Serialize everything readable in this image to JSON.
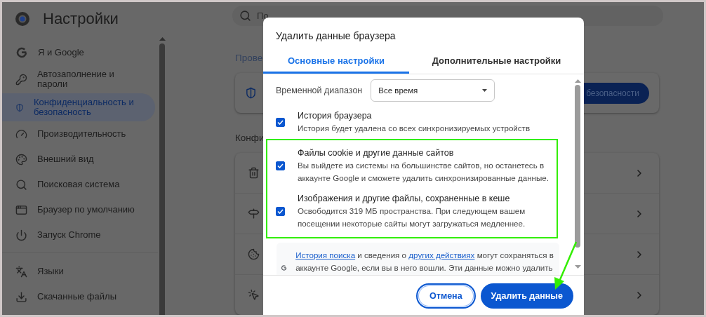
{
  "sidebar": {
    "title": "Настройки",
    "items": [
      {
        "label": "Я и Google",
        "selected": false
      },
      {
        "label": "Автозаполнение и пароли",
        "selected": false
      },
      {
        "label": "Конфиденциальность и безопасность",
        "selected": true
      },
      {
        "label": "Производительность",
        "selected": false
      },
      {
        "label": "Внешний вид",
        "selected": false
      },
      {
        "label": "Поисковая система",
        "selected": false
      },
      {
        "label": "Браузер по умолчанию",
        "selected": false
      },
      {
        "label": "Запуск Chrome",
        "selected": false
      }
    ],
    "more_items": [
      {
        "label": "Языки",
        "selected": false
      },
      {
        "label": "Скачанные файлы",
        "selected": false
      }
    ]
  },
  "search": {
    "placeholder": "По"
  },
  "main": {
    "section_1_heading": "Прове",
    "safety_button": "безопасности",
    "section_2_heading": "Конфи"
  },
  "dialog": {
    "title": "Удалить данные браузера",
    "tabs": [
      {
        "label": "Основные настройки",
        "selected": true
      },
      {
        "label": "Дополнительные настройки",
        "selected": false
      }
    ],
    "time_range": {
      "label": "Временной диапазон",
      "value": "Все время"
    },
    "options": [
      {
        "title": "История браузера",
        "description": "История будет удалена со всех синхронизируемых устройств",
        "checked": true,
        "highlighted": false
      },
      {
        "title": "Файлы cookie и другие данные сайтов",
        "description": "Вы выйдете из системы на большинстве сайтов, но останетесь в аккаунте Google и сможете удалить синхронизированные данные.",
        "checked": true,
        "highlighted": true
      },
      {
        "title": "Изображения и другие файлы, сохраненные в кеше",
        "description": "Освободится 319 МБ пространства. При следующем вашем посещении некоторые сайты могут загружаться медленнее.",
        "checked": true,
        "highlighted": true
      }
    ],
    "info": [
      {
        "kind": "link",
        "text": "История поиска"
      },
      {
        "kind": "text",
        "text": " и сведения о "
      },
      {
        "kind": "link",
        "text": "других действиях"
      },
      {
        "kind": "text",
        "text": " могут сохраняться в аккаунте Google, если вы в него вошли. Эти данные можно удалить"
      }
    ],
    "buttons": [
      {
        "label": "Отмена",
        "kind": "secondary"
      },
      {
        "label": "Удалить данные",
        "kind": "primary"
      }
    ]
  }
}
